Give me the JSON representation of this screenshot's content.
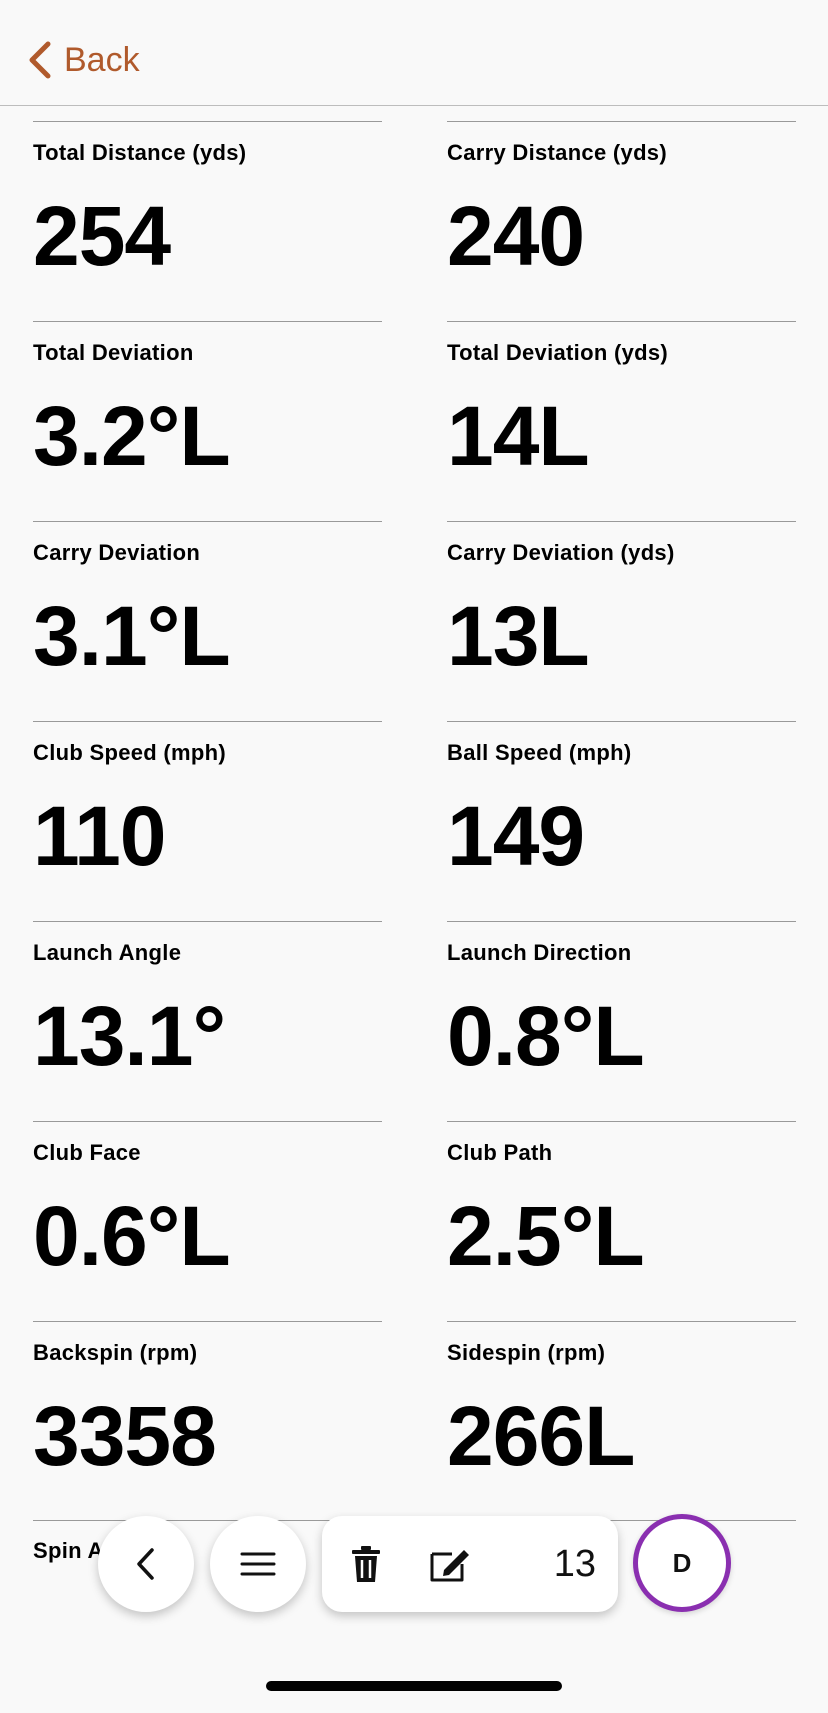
{
  "nav": {
    "back_label": "Back"
  },
  "metrics": [
    {
      "label": "Total Distance (yds)",
      "value": "254"
    },
    {
      "label": "Carry Distance (yds)",
      "value": "240"
    },
    {
      "label": "Total Deviation",
      "value": "3.2°L"
    },
    {
      "label": "Total Deviation (yds)",
      "value": "14L"
    },
    {
      "label": "Carry Deviation",
      "value": "3.1°L"
    },
    {
      "label": "Carry Deviation (yds)",
      "value": "13L"
    },
    {
      "label": "Club Speed (mph)",
      "value": "110"
    },
    {
      "label": "Ball Speed (mph)",
      "value": "149"
    },
    {
      "label": "Launch Angle",
      "value": "13.1°"
    },
    {
      "label": "Launch Direction",
      "value": "0.8°L"
    },
    {
      "label": "Club Face",
      "value": "0.6°L"
    },
    {
      "label": "Club Path",
      "value": "2.5°L"
    },
    {
      "label": "Backspin (rpm)",
      "value": "3358"
    },
    {
      "label": "Sidespin (rpm)",
      "value": "266L"
    }
  ],
  "partial_label": "Spin A",
  "toolbar": {
    "prev_icon": "chevron-left-icon",
    "menu_icon": "hamburger-icon",
    "delete_icon": "trash-icon",
    "edit_icon": "edit-icon",
    "count": "13",
    "club_label": "D"
  },
  "colors": {
    "accent": "#b05a2c",
    "club_ring": "#8a2fb0"
  }
}
